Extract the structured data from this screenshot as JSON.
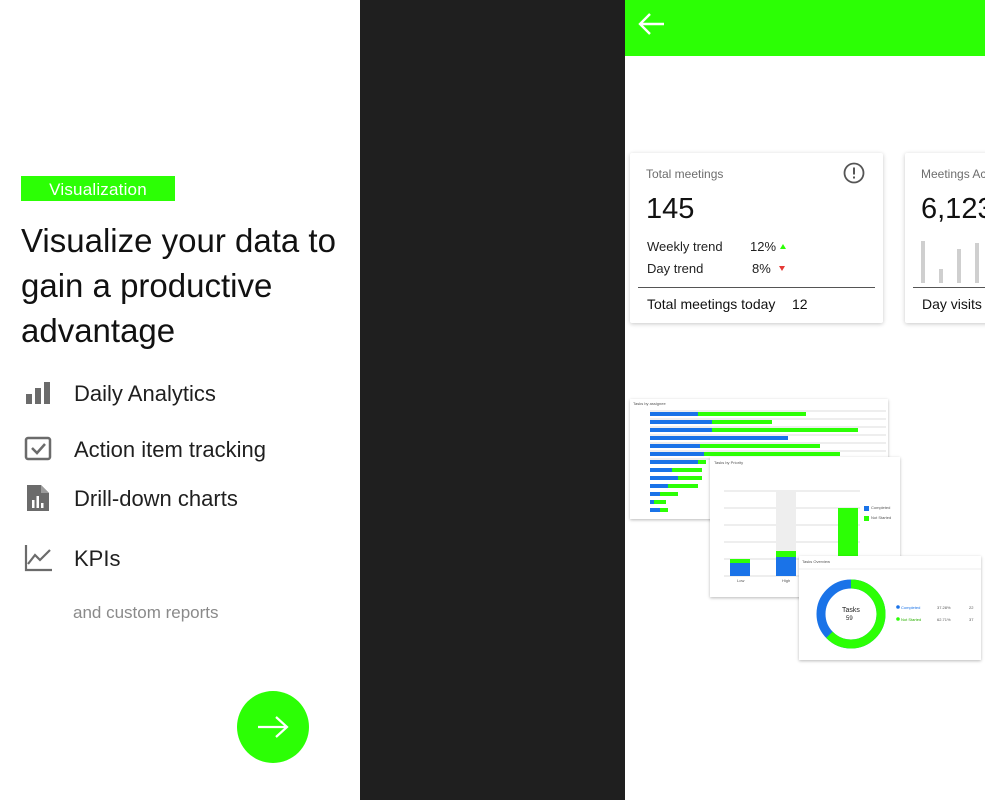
{
  "intro": {
    "badge": "Visualization",
    "headline": "Visualize your data to gain a productive advantage",
    "features": [
      {
        "icon": "bar-chart-icon",
        "label": "Daily Analytics"
      },
      {
        "icon": "checkbox-icon",
        "label": "Action item tracking"
      },
      {
        "icon": "report-file-icon",
        "label": "Drill-down charts"
      },
      {
        "icon": "line-chart-icon",
        "label": "KPIs"
      }
    ],
    "more": "and custom reports",
    "next_icon": "arrow-right-icon"
  },
  "colors": {
    "accent": "#2cff05",
    "dark_bg": "#1f1f1f",
    "blue": "#1a73e8",
    "down": "#e53935"
  },
  "phone": {
    "back_icon": "arrow-left-icon",
    "card1": {
      "title": "Total meetings",
      "value": "145",
      "trends": [
        {
          "label": "Weekly trend",
          "value": "12%",
          "direction": "up"
        },
        {
          "label": "Day trend",
          "value": "8%",
          "direction": "down"
        }
      ],
      "footer_label": "Total meetings today",
      "footer_value": "12"
    },
    "card2": {
      "title": "Meetings Ac",
      "value": "6,123",
      "footer_label": "Day visits"
    },
    "mini_charts": {
      "m1_title": "Tasks by assignee",
      "m2_title": "Tasks by Priority",
      "m2_legend": [
        "Completed",
        "Not Started"
      ],
      "m2_categories": [
        "Low",
        "High"
      ],
      "m3_title": "Tasks Overview",
      "m3_center_label": "Tasks",
      "m3_center_value": "59",
      "m3_legend": [
        {
          "name": "Completed",
          "pct": "37.28%",
          "count": "22"
        },
        {
          "name": "Not Started",
          "pct": "62.71%",
          "count": "37"
        }
      ]
    }
  }
}
